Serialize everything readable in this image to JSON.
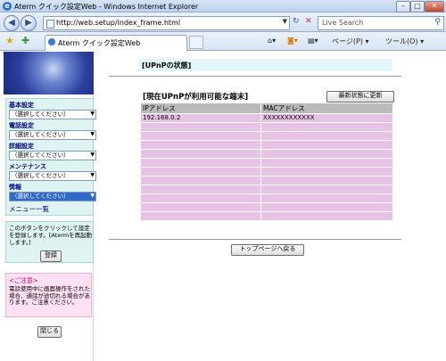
{
  "window": {
    "title": "Aterm クイック設定Web - Windows Internet Explorer",
    "minimize": "–",
    "maximize": "□",
    "close": "✕"
  },
  "address": {
    "url": "http://web.setup/index_frame.html",
    "search_placeholder": "Live Search"
  },
  "tab": {
    "label": "Aterm クイック設定Web"
  },
  "toolbar": {
    "page_label": "ページ(P)",
    "tools_label": "ツール(O)"
  },
  "sidebar": {
    "menu": [
      {
        "label": "基本設定",
        "select": "（選択してください）"
      },
      {
        "label": "電話設定",
        "select": "（選択してください）"
      },
      {
        "label": "詳細設定",
        "select": "（選択してください）"
      },
      {
        "label": "メンテナンス",
        "select": "（選択してください）"
      },
      {
        "label": "情報",
        "select": "（選択してください）"
      }
    ],
    "menu_list_link": "メニュー一覧",
    "info_text": "このボタンをクリックして設定を登録します。[Atermを再起動します。]",
    "register_button": "登録",
    "notice_title": "<ご注意>",
    "notice_text": "電話使用中に画面操作をされた場合、通話が途切れる場合があります。ご注意ください。",
    "close_button": "閉じる"
  },
  "main": {
    "page_title": "[UPnPの状態]",
    "section_title": "[現在UPnPが利用可能な端末]",
    "refresh_button": "最新状態に更新",
    "table": {
      "headers": [
        "IPアドレス",
        "MACアドレス"
      ],
      "rows": [
        [
          "192.168.0.2",
          "XXXXXXXXXXXX"
        ],
        [
          "",
          ""
        ],
        [
          "",
          ""
        ],
        [
          "",
          ""
        ],
        [
          "",
          ""
        ],
        [
          "",
          ""
        ],
        [
          "",
          ""
        ],
        [
          "",
          ""
        ],
        [
          "",
          ""
        ],
        [
          "",
          ""
        ],
        [
          "",
          ""
        ],
        [
          "",
          ""
        ]
      ]
    },
    "top_button": "トップページへ戻る"
  }
}
